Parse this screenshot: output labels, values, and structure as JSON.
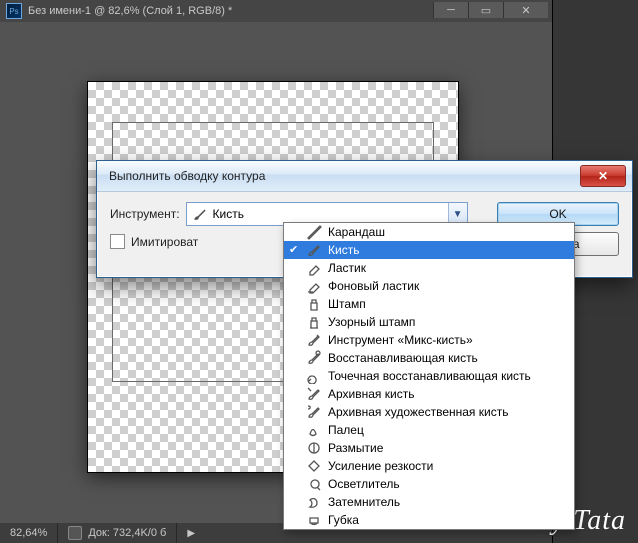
{
  "ps": {
    "title": "Без имени-1 @ 82,6% (Слой 1, RGB/8) *",
    "title_logo": "Ps",
    "zoom": "82,64%",
    "doc_info": "Док: 732,4K/0 б"
  },
  "dialog": {
    "title": "Выполнить обводку контура",
    "instrument_label": "Инструмент:",
    "selected_tool": "Кисть",
    "simulate_label": "Имитироват",
    "ok": "OK",
    "cancel": "Отмена"
  },
  "tools": [
    {
      "label": "Карандаш",
      "selected": false
    },
    {
      "label": "Кисть",
      "selected": true
    },
    {
      "label": "Ластик",
      "selected": false
    },
    {
      "label": "Фоновый ластик",
      "selected": false
    },
    {
      "label": "Штамп",
      "selected": false
    },
    {
      "label": "Узорный штамп",
      "selected": false
    },
    {
      "label": "Инструмент «Микс-кисть»",
      "selected": false
    },
    {
      "label": "Восстанавливающая кисть",
      "selected": false
    },
    {
      "label": "Точечная восстанавливающая кисть",
      "selected": false
    },
    {
      "label": "Архивная кисть",
      "selected": false
    },
    {
      "label": "Архивная художественная кисть",
      "selected": false
    },
    {
      "label": "Палец",
      "selected": false
    },
    {
      "label": "Размытие",
      "selected": false
    },
    {
      "label": "Усиление резкости",
      "selected": false
    },
    {
      "label": "Осветлитель",
      "selected": false
    },
    {
      "label": "Затемнитель",
      "selected": false
    },
    {
      "label": "Губка",
      "selected": false
    }
  ],
  "watermark": "by Tata"
}
